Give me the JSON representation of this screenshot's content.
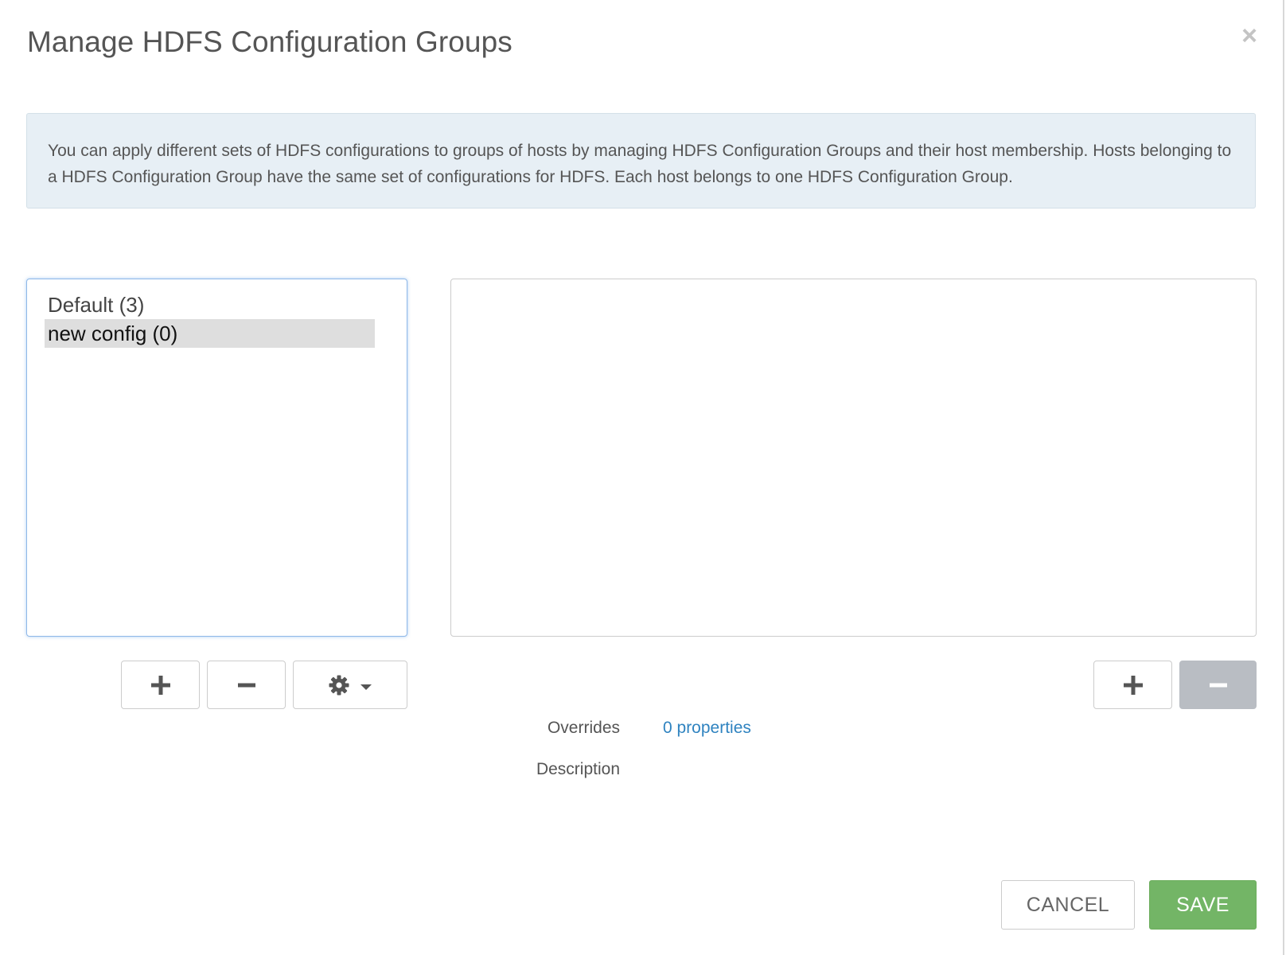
{
  "modal": {
    "title": "Manage HDFS Configuration Groups",
    "close_label": "×",
    "info_text": "You can apply different sets of HDFS configurations to groups of hosts by managing HDFS Configuration Groups and their host membership. Hosts belonging to a HDFS Configuration Group have the same set of configurations for HDFS. Each host belongs to one HDFS Configuration Group."
  },
  "config_groups": {
    "items": [
      {
        "label": "Default (3)",
        "selected": false
      },
      {
        "label": "new config (0)",
        "selected": true
      }
    ],
    "buttons": {
      "add_icon": "plus-icon",
      "remove_icon": "minus-icon",
      "settings_icon": "gear-icon",
      "dropdown_icon": "caret-down-icon"
    }
  },
  "hosts": {
    "items": [],
    "buttons": {
      "add_icon": "plus-icon",
      "remove_icon": "minus-icon",
      "remove_disabled": true
    }
  },
  "details": {
    "overrides_label": "Overrides",
    "overrides_value": "0 properties",
    "description_label": "Description",
    "description_value": ""
  },
  "footer": {
    "cancel_label": "CANCEL",
    "save_label": "SAVE"
  },
  "colors": {
    "save_green": "#73b566",
    "link_blue": "#2f83c0",
    "info_bg": "#e7eff5",
    "selected_bg": "#dedede",
    "disabled_button": "#b9bdc3"
  }
}
